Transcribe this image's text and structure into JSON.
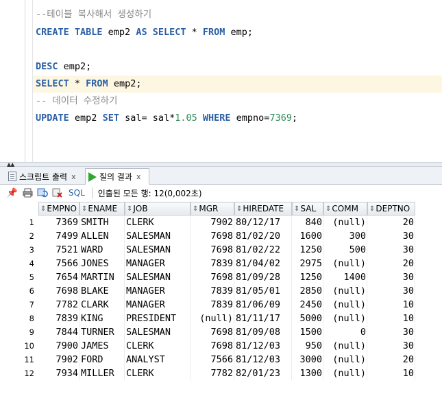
{
  "editor": {
    "lines": [
      {
        "type": "comment",
        "text": "--테이블 복사해서 생성하기"
      },
      {
        "type": "code",
        "parts": [
          [
            "kw",
            "CREATE TABLE"
          ],
          [
            "t",
            " emp2 "
          ],
          [
            "kw",
            "AS SELECT"
          ],
          [
            "t",
            " * "
          ],
          [
            "kw",
            "FROM"
          ],
          [
            "t",
            " emp;"
          ]
        ]
      },
      {
        "type": "blank"
      },
      {
        "type": "code",
        "parts": [
          [
            "kw",
            "DESC"
          ],
          [
            "t",
            " emp2;"
          ]
        ]
      },
      {
        "type": "code",
        "highlight": true,
        "parts": [
          [
            "kw",
            "SELECT"
          ],
          [
            "t",
            " * "
          ],
          [
            "kw",
            "FROM"
          ],
          [
            "t",
            " emp2;"
          ]
        ]
      },
      {
        "type": "comment",
        "text": "-- 데이터 수정하기"
      },
      {
        "type": "code",
        "parts": [
          [
            "kw",
            "UPDATE"
          ],
          [
            "t",
            " emp2 "
          ],
          [
            "kw",
            "SET"
          ],
          [
            "t",
            " sal= sal*"
          ],
          [
            "num",
            "1.05"
          ],
          [
            "t",
            " "
          ],
          [
            "kw",
            "WHERE"
          ],
          [
            "t",
            " empno="
          ],
          [
            "num",
            "7369"
          ],
          [
            "t",
            ";"
          ]
        ]
      }
    ]
  },
  "splitter": {
    "arrows": "▲▲"
  },
  "tabs": [
    {
      "label": "스크립트 출력",
      "close": "x",
      "active": false,
      "icon": "script-output-icon"
    },
    {
      "label": "질의 결과",
      "close": "x",
      "active": true,
      "icon": "run-query-icon"
    }
  ],
  "toolbar": {
    "sql_label": "SQL",
    "fetch_text": "인출된 모든 행: 12(0,002초)"
  },
  "grid": {
    "columns": [
      "EMPNO",
      "ENAME",
      "JOB",
      "MGR",
      "HIREDATE",
      "SAL",
      "COMM",
      "DEPTNO"
    ],
    "rows": [
      [
        "1",
        "7369",
        "SMITH",
        "CLERK",
        "7902",
        "80/12/17",
        "840",
        "(null)",
        "20"
      ],
      [
        "2",
        "7499",
        "ALLEN",
        "SALESMAN",
        "7698",
        "81/02/20",
        "1600",
        "300",
        "30"
      ],
      [
        "3",
        "7521",
        "WARD",
        "SALESMAN",
        "7698",
        "81/02/22",
        "1250",
        "500",
        "30"
      ],
      [
        "4",
        "7566",
        "JONES",
        "MANAGER",
        "7839",
        "81/04/02",
        "2975",
        "(null)",
        "20"
      ],
      [
        "5",
        "7654",
        "MARTIN",
        "SALESMAN",
        "7698",
        "81/09/28",
        "1250",
        "1400",
        "30"
      ],
      [
        "6",
        "7698",
        "BLAKE",
        "MANAGER",
        "7839",
        "81/05/01",
        "2850",
        "(null)",
        "30"
      ],
      [
        "7",
        "7782",
        "CLARK",
        "MANAGER",
        "7839",
        "81/06/09",
        "2450",
        "(null)",
        "10"
      ],
      [
        "8",
        "7839",
        "KING",
        "PRESIDENT",
        "(null)",
        "81/11/17",
        "5000",
        "(null)",
        "10"
      ],
      [
        "9",
        "7844",
        "TURNER",
        "SALESMAN",
        "7698",
        "81/09/08",
        "1500",
        "0",
        "30"
      ],
      [
        "10",
        "7900",
        "JAMES",
        "CLERK",
        "7698",
        "81/12/03",
        "950",
        "(null)",
        "30"
      ],
      [
        "11",
        "7902",
        "FORD",
        "ANALYST",
        "7566",
        "81/12/03",
        "3000",
        "(null)",
        "20"
      ],
      [
        "12",
        "7934",
        "MILLER",
        "CLERK",
        "7782",
        "82/01/23",
        "1300",
        "(null)",
        "10"
      ]
    ]
  }
}
